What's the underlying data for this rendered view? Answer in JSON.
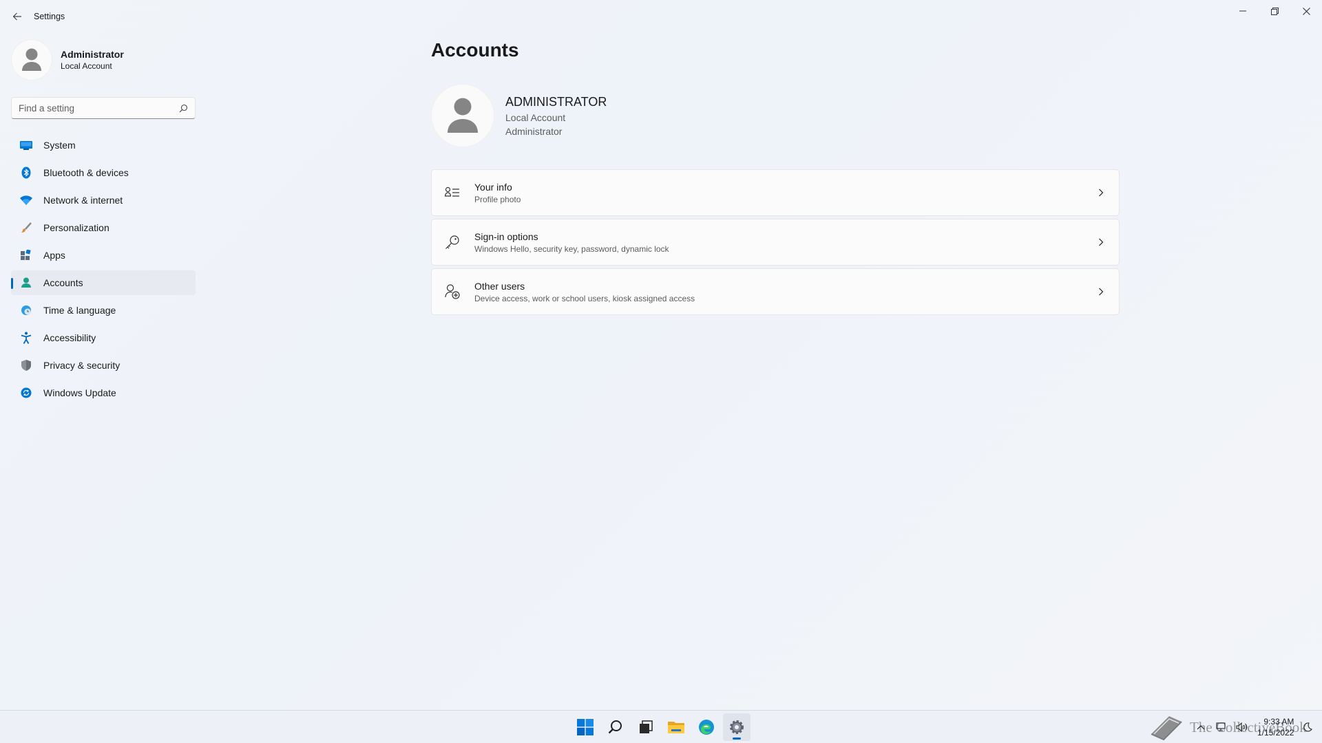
{
  "window": {
    "title": "Settings"
  },
  "sidebar": {
    "user": {
      "name": "Administrator",
      "account_type": "Local Account"
    },
    "search": {
      "placeholder": "Find a setting"
    },
    "items": [
      {
        "label": "System",
        "icon": "monitor-icon",
        "active": false
      },
      {
        "label": "Bluetooth & devices",
        "icon": "bluetooth-icon",
        "active": false
      },
      {
        "label": "Network & internet",
        "icon": "wifi-icon",
        "active": false
      },
      {
        "label": "Personalization",
        "icon": "brush-icon",
        "active": false
      },
      {
        "label": "Apps",
        "icon": "apps-icon",
        "active": false
      },
      {
        "label": "Accounts",
        "icon": "person-icon",
        "active": true
      },
      {
        "label": "Time & language",
        "icon": "globe-clock-icon",
        "active": false
      },
      {
        "label": "Accessibility",
        "icon": "accessibility-icon",
        "active": false
      },
      {
        "label": "Privacy & security",
        "icon": "shield-icon",
        "active": false
      },
      {
        "label": "Windows Update",
        "icon": "update-icon",
        "active": false
      }
    ]
  },
  "main": {
    "title": "Accounts",
    "account": {
      "name": "ADMINISTRATOR",
      "type": "Local Account",
      "role": "Administrator"
    },
    "rows": [
      {
        "title": "Your info",
        "subtitle": "Profile photo",
        "icon": "contact-card-icon"
      },
      {
        "title": "Sign-in options",
        "subtitle": "Windows Hello, security key, password, dynamic lock",
        "icon": "key-icon"
      },
      {
        "title": "Other users",
        "subtitle": "Device access, work or school users, kiosk assigned access",
        "icon": "add-user-icon"
      }
    ]
  },
  "taskbar": {
    "apps": [
      "windows-start-icon",
      "search-icon",
      "task-view-icon",
      "file-explorer-icon",
      "edge-icon",
      "settings-gear-icon"
    ],
    "watermark": "The CollectiveBook",
    "time": "9:33 AM",
    "date": "1/15/2022"
  },
  "colors": {
    "accent": "#0067c0",
    "background": "#f1f4f9",
    "card": "#fbfbfc"
  }
}
